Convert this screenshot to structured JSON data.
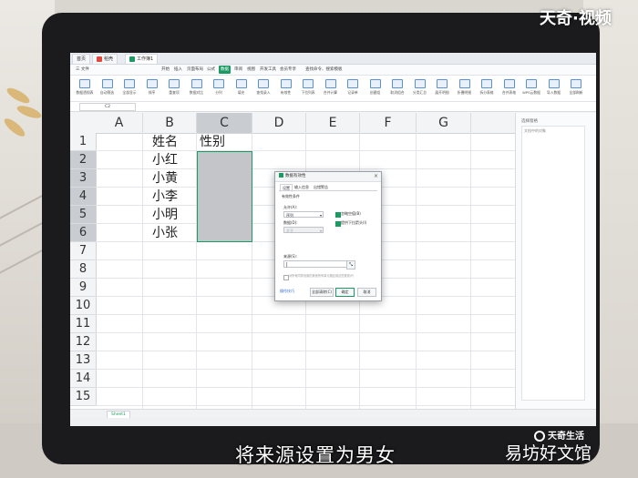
{
  "app": {
    "tabs": [
      {
        "label": "首页"
      },
      {
        "label": "稻壳"
      },
      {
        "label": "工作簿1"
      }
    ],
    "ribbon_tabs": [
      "三 文件",
      "开始",
      "插入",
      "页面布局",
      "公式",
      "数据",
      "审阅",
      "视图",
      "开发工具",
      "会员专享",
      "查找命令、搜索模板"
    ],
    "active_ribbon_tab": "数据",
    "ribbon_buttons": [
      "数据透视表",
      "自动筛选",
      "全部显示",
      "排序",
      "重复项",
      "数据对比",
      "分列",
      "填充",
      "查找录入",
      "有效性",
      "下拉列表",
      "合并计算",
      "记录单",
      "创建组",
      "取消组合",
      "分类汇总",
      "展开明细",
      "折叠明细",
      "拆分表格",
      "合并表格",
      "WPS云数据",
      "导入数据",
      "全部刷新"
    ],
    "name_box": "C2",
    "sheet_tab": "Sheet1"
  },
  "grid": {
    "columns": [
      "A",
      "B",
      "C",
      "D",
      "E",
      "F",
      "G"
    ],
    "rows": [
      "1",
      "2",
      "3",
      "4",
      "5",
      "6",
      "7",
      "8",
      "9",
      "10",
      "11",
      "12",
      "13",
      "14",
      "15"
    ],
    "b1": "姓名",
    "c1": "性别",
    "names": [
      "小红",
      "小黄",
      "小李",
      "小明",
      "小张"
    ]
  },
  "side_panel": {
    "title": "选择窗格",
    "subtitle": "文档中的对象"
  },
  "dialog": {
    "title": "数据有效性",
    "close": "×",
    "tabs": [
      "设置",
      "输入信息",
      "出错警告"
    ],
    "section": "有效性条件",
    "allow_label": "允许(A):",
    "allow_value": "序列",
    "data_label": "数据(D):",
    "data_value": "介于",
    "ignore_blank": "忽略空值(B)",
    "dropdown": "提供下拉箭头(I)",
    "source_label": "来源(S):",
    "source_value": "|",
    "apply_all": "对所有同样设置的其他所有单元格应用这些更改(P)",
    "link": "操作技巧",
    "clear_btn": "全部清除(C)",
    "ok_btn": "确定",
    "cancel_btn": "取消"
  },
  "overlay": {
    "watermark": "天奇·视频",
    "subtitle": "将来源设置为男女",
    "brand1": "天奇生活",
    "brand2": "易坊好文馆"
  }
}
